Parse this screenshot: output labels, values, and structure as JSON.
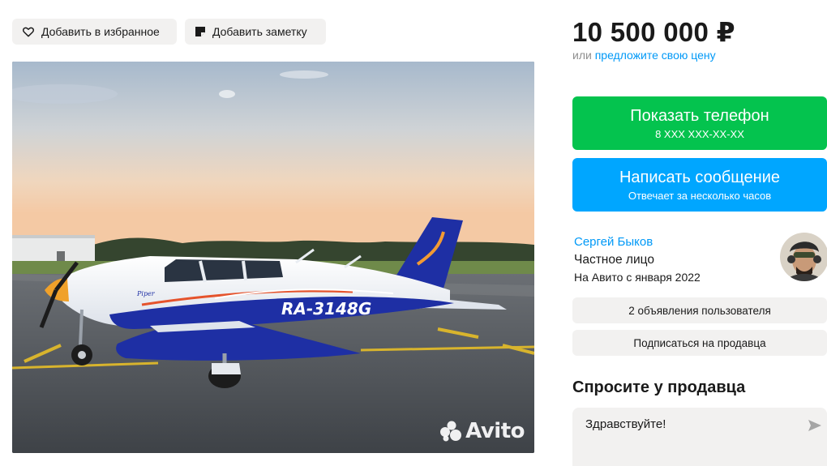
{
  "actions": {
    "favorite_label": "Добавить в избранное",
    "note_label": "Добавить заметку"
  },
  "photo": {
    "registration": "RA-3148G",
    "brand_script": "Piper",
    "watermark": "Avito"
  },
  "price": {
    "amount": "10 500 000 ₽",
    "offer_prefix": "или",
    "offer_link": "предложите свою цену"
  },
  "contact": {
    "phone_label": "Показать телефон",
    "phone_masked": "8 XXX XXX-XX-XX",
    "message_label": "Написать сообщение",
    "message_sub": "Отвечает за несколько часов"
  },
  "seller": {
    "name": "Сергей Быков",
    "type": "Частное лицо",
    "since": "На Авито с января 2022",
    "ads_label": "2 объявления пользователя",
    "subscribe_label": "Подписаться на продавца"
  },
  "ask": {
    "title": "Спросите у продавца",
    "message_value": "Здравствуйте!"
  },
  "colors": {
    "green": "#04c34e",
    "blue": "#00a6ff",
    "link": "#0099f7",
    "button_gray": "#f2f1f0"
  },
  "icons": [
    "heart-icon",
    "note-icon",
    "send-icon",
    "avito-logo-icon"
  ]
}
